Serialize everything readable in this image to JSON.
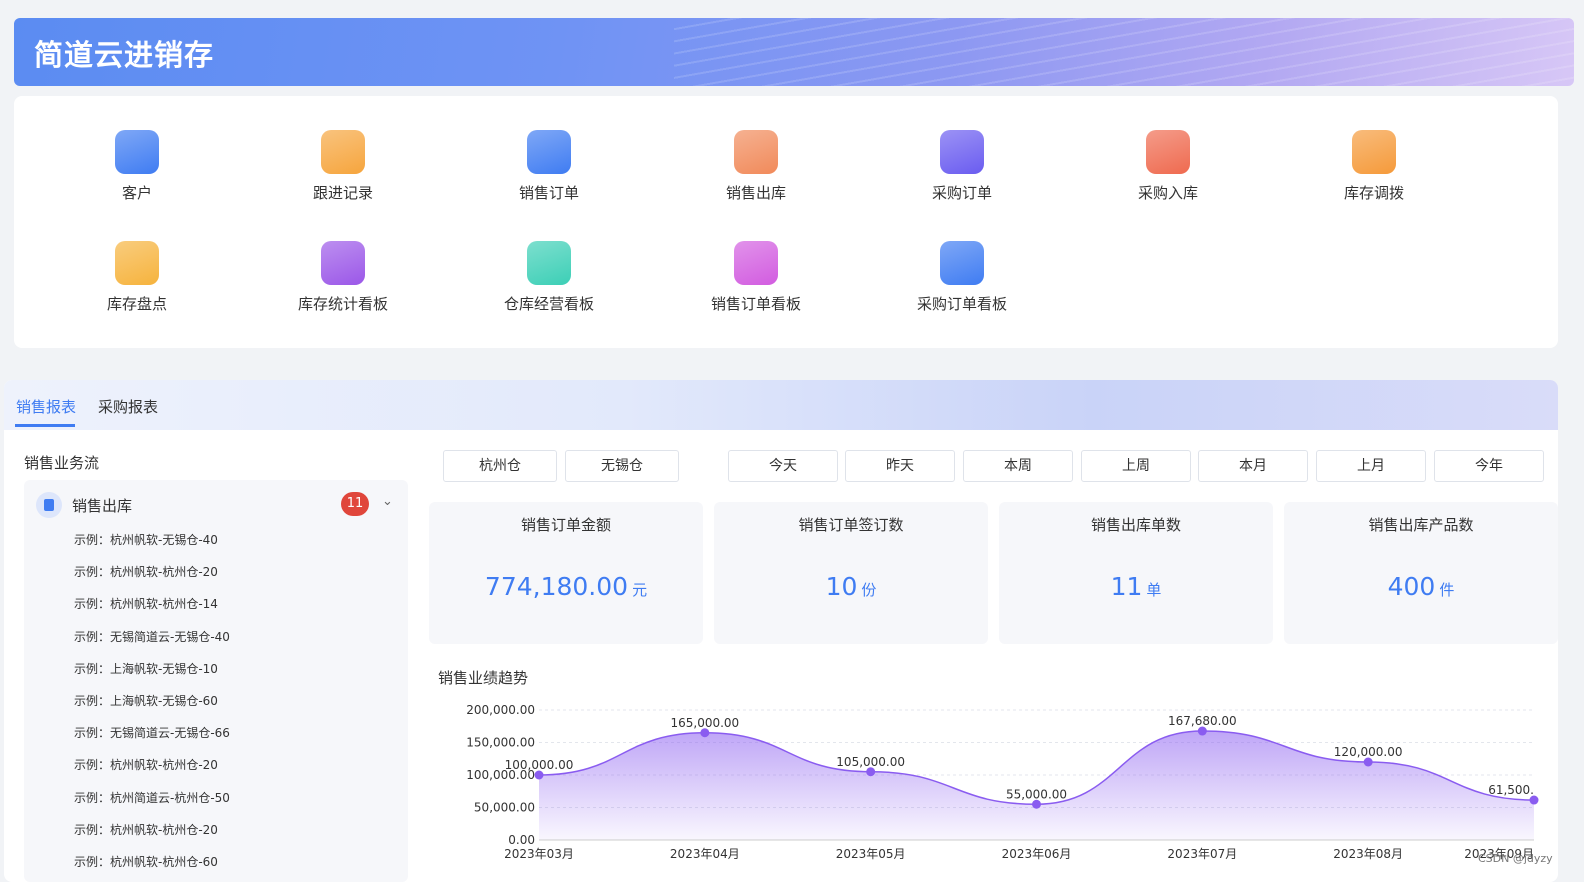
{
  "app": {
    "title": "简道云进销存"
  },
  "nav": {
    "items": [
      {
        "label": "客户",
        "icon": "customer-icon",
        "color": "#3f7cf2"
      },
      {
        "label": "跟进记录",
        "icon": "shield-check-icon",
        "color": "#f6a53d"
      },
      {
        "label": "销售订单",
        "icon": "document-list-icon",
        "color": "#3f7cf2"
      },
      {
        "label": "销售出库",
        "icon": "export-icon",
        "color": "#f18a5a"
      },
      {
        "label": "采购订单",
        "icon": "cart-icon",
        "color": "#6a5cf0"
      },
      {
        "label": "采购入库",
        "icon": "flag-star-icon",
        "color": "#ef6a4f"
      },
      {
        "label": "库存调拨",
        "icon": "transfer-box-icon",
        "color": "#f59a3a"
      },
      {
        "label": "库存盘点",
        "icon": "folder-icon",
        "color": "#f6b33d"
      },
      {
        "label": "库存统计看板",
        "icon": "chart-circle-icon",
        "color": "#9b57e8"
      },
      {
        "label": "仓库经营看板",
        "icon": "bar-chart-icon",
        "color": "#3ccfb6"
      },
      {
        "label": "销售订单看板",
        "icon": "card-icon",
        "color": "#d25ce0"
      },
      {
        "label": "采购订单看板",
        "icon": "calendar-icon",
        "color": "#3f7cf2"
      }
    ]
  },
  "report": {
    "tabs": [
      "销售报表",
      "采购报表"
    ],
    "flow": {
      "title": "销售业务流",
      "name": "销售出库",
      "count": "11",
      "rows": [
        "示例：杭州帆软-无锡仓-40",
        "示例：杭州帆软-杭州仓-20",
        "示例：杭州帆软-杭州仓-14",
        "示例：无锡简道云-无锡仓-40",
        "示例：上海帆软-无锡仓-10",
        "示例：上海帆软-无锡仓-60",
        "示例：无锡简道云-无锡仓-66",
        "示例：杭州帆软-杭州仓-20",
        "示例：杭州简道云-杭州仓-50",
        "示例：杭州帆软-杭州仓-20",
        "示例：杭州帆软-杭州仓-60"
      ]
    },
    "warehouses": [
      "杭州仓",
      "无锡仓"
    ],
    "periods": [
      "今天",
      "昨天",
      "本周",
      "上周",
      "本月",
      "上月",
      "今年"
    ],
    "kpis": [
      {
        "title": "销售订单金额",
        "value": "774,180.00",
        "unit": "元"
      },
      {
        "title": "销售订单签订数",
        "value": "10",
        "unit": "份"
      },
      {
        "title": "销售出库单数",
        "value": "11",
        "unit": "单"
      },
      {
        "title": "销售出库产品数",
        "value": "400",
        "unit": "件"
      }
    ],
    "trend_title": "销售业绩趋势"
  },
  "chart_data": {
    "type": "area",
    "categories": [
      "2023年03月",
      "2023年04月",
      "2023年05月",
      "2023年06月",
      "2023年07月",
      "2023年08月",
      "2023年09月"
    ],
    "values": [
      100000,
      165000,
      105000,
      55000,
      167680,
      120000,
      61500
    ],
    "value_labels": [
      "100,000.00",
      "165,000.00",
      "105,000.00",
      "55,000.00",
      "167,680.00",
      "120,000.00",
      "61,500."
    ],
    "y_ticks": [
      "0.00",
      "50,000.00",
      "100,000.00",
      "150,000.00",
      "200,000.00"
    ],
    "ylim": [
      0,
      200000
    ],
    "color": "#8a5cf0"
  },
  "watermark": "CSDN @jdyzy"
}
